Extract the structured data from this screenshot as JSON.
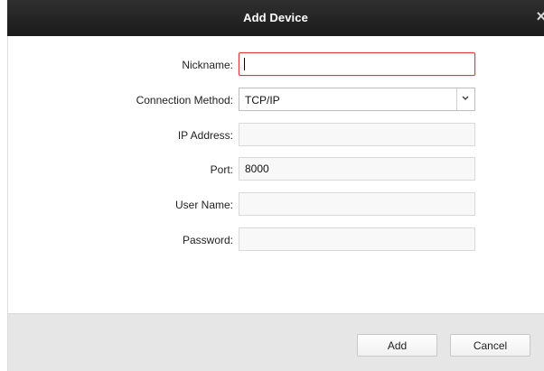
{
  "dialog": {
    "title": "Add Device",
    "close_glyph": "×"
  },
  "form": {
    "nickname": {
      "label": "Nickname:",
      "value": ""
    },
    "connection_method": {
      "label": "Connection Method:",
      "value": "TCP/IP"
    },
    "ip_address": {
      "label": "IP Address:",
      "value": ""
    },
    "port": {
      "label": "Port:",
      "value": "8000"
    },
    "user_name": {
      "label": "User Name:",
      "value": ""
    },
    "password": {
      "label": "Password:",
      "value": ""
    }
  },
  "buttons": {
    "add": "Add",
    "cancel": "Cancel"
  },
  "icons": {
    "close": "close-icon",
    "dropdown": "chevron-down-icon"
  },
  "colors": {
    "titlebar": "#232323",
    "focus_border": "#e03a3a",
    "footer_background": "#e6e6e6"
  }
}
